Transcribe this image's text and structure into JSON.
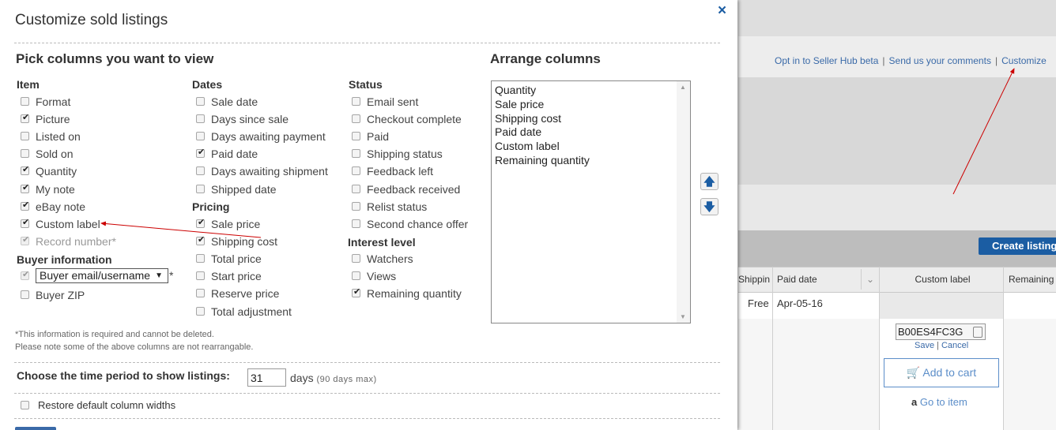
{
  "modal": {
    "title": "Customize sold listings",
    "close": "×",
    "pick_heading": "Pick columns you want to view",
    "arrange_heading": "Arrange columns",
    "groups": {
      "item": {
        "heading": "Item",
        "options": [
          {
            "label": "Format",
            "checked": false
          },
          {
            "label": "Picture",
            "checked": true
          },
          {
            "label": "Listed on",
            "checked": false
          },
          {
            "label": "Sold on",
            "checked": false
          },
          {
            "label": "Quantity",
            "checked": true
          },
          {
            "label": "My note",
            "checked": true
          },
          {
            "label": "eBay note",
            "checked": true
          },
          {
            "label": "Custom label",
            "checked": true
          },
          {
            "label": "Record number*",
            "checked": true,
            "disabled": true
          }
        ]
      },
      "buyer": {
        "heading": "Buyer information",
        "select_value": "Buyer email/username",
        "select_required_mark": "*",
        "zip_label": "Buyer ZIP",
        "zip_checked": false
      },
      "dates": {
        "heading": "Dates",
        "options": [
          {
            "label": "Sale date",
            "checked": false
          },
          {
            "label": "Days since sale",
            "checked": false
          },
          {
            "label": "Days awaiting payment",
            "checked": false
          },
          {
            "label": "Paid date",
            "checked": true
          },
          {
            "label": "Days awaiting shipment",
            "checked": false
          },
          {
            "label": "Shipped date",
            "checked": false
          }
        ]
      },
      "pricing": {
        "heading": "Pricing",
        "options": [
          {
            "label": "Sale price",
            "checked": true
          },
          {
            "label": "Shipping cost",
            "checked": true
          },
          {
            "label": "Total price",
            "checked": false
          },
          {
            "label": "Start price",
            "checked": false
          },
          {
            "label": "Reserve price",
            "checked": false
          },
          {
            "label": "Total adjustment",
            "checked": false
          }
        ]
      },
      "status": {
        "heading": "Status",
        "options": [
          {
            "label": "Email sent",
            "checked": false
          },
          {
            "label": "Checkout complete",
            "checked": false
          },
          {
            "label": "Paid",
            "checked": false
          },
          {
            "label": "Shipping status",
            "checked": false
          },
          {
            "label": "Feedback left",
            "checked": false
          },
          {
            "label": "Feedback received",
            "checked": false
          },
          {
            "label": "Relist status",
            "checked": false
          },
          {
            "label": "Second chance offer",
            "checked": false
          }
        ]
      },
      "interest": {
        "heading": "Interest level",
        "options": [
          {
            "label": "Watchers",
            "checked": false
          },
          {
            "label": "Views",
            "checked": false
          },
          {
            "label": "Remaining quantity",
            "checked": true
          }
        ]
      }
    },
    "arrange_list": [
      "Quantity",
      "Sale price",
      "Shipping cost",
      "Paid date",
      "Custom label",
      "Remaining quantity"
    ],
    "move_up_icon": "arrow-up-icon",
    "move_down_icon": "arrow-down-icon",
    "note_required": "*This information is required and cannot be deleted.",
    "note_rearrange": "Please note some of the above columns are not rearrangable.",
    "time_period_label": "Choose the time period to show listings:",
    "days_value": "31",
    "days_label": "days",
    "days_max": "(90 days max)",
    "restore_label": "Restore default column widths",
    "restore_checked": false
  },
  "background": {
    "links": [
      "Opt in to Seller Hub beta",
      "Send us your comments",
      "Customize"
    ],
    "link_separator": "|",
    "create_button": "Create listing",
    "columns": [
      "Shipping cost",
      "Paid date",
      "Custom label",
      "Remaining"
    ],
    "row": {
      "shipping": "Free",
      "paid_date": "Apr-05-16",
      "sku": "B00ES4FC3G"
    },
    "save": "Save",
    "cancel": "Cancel",
    "add_to_cart": "Add to cart",
    "go_to_item": "Go to item",
    "accent_color": "#1b5da3",
    "annotation_color": "#cc0000"
  }
}
